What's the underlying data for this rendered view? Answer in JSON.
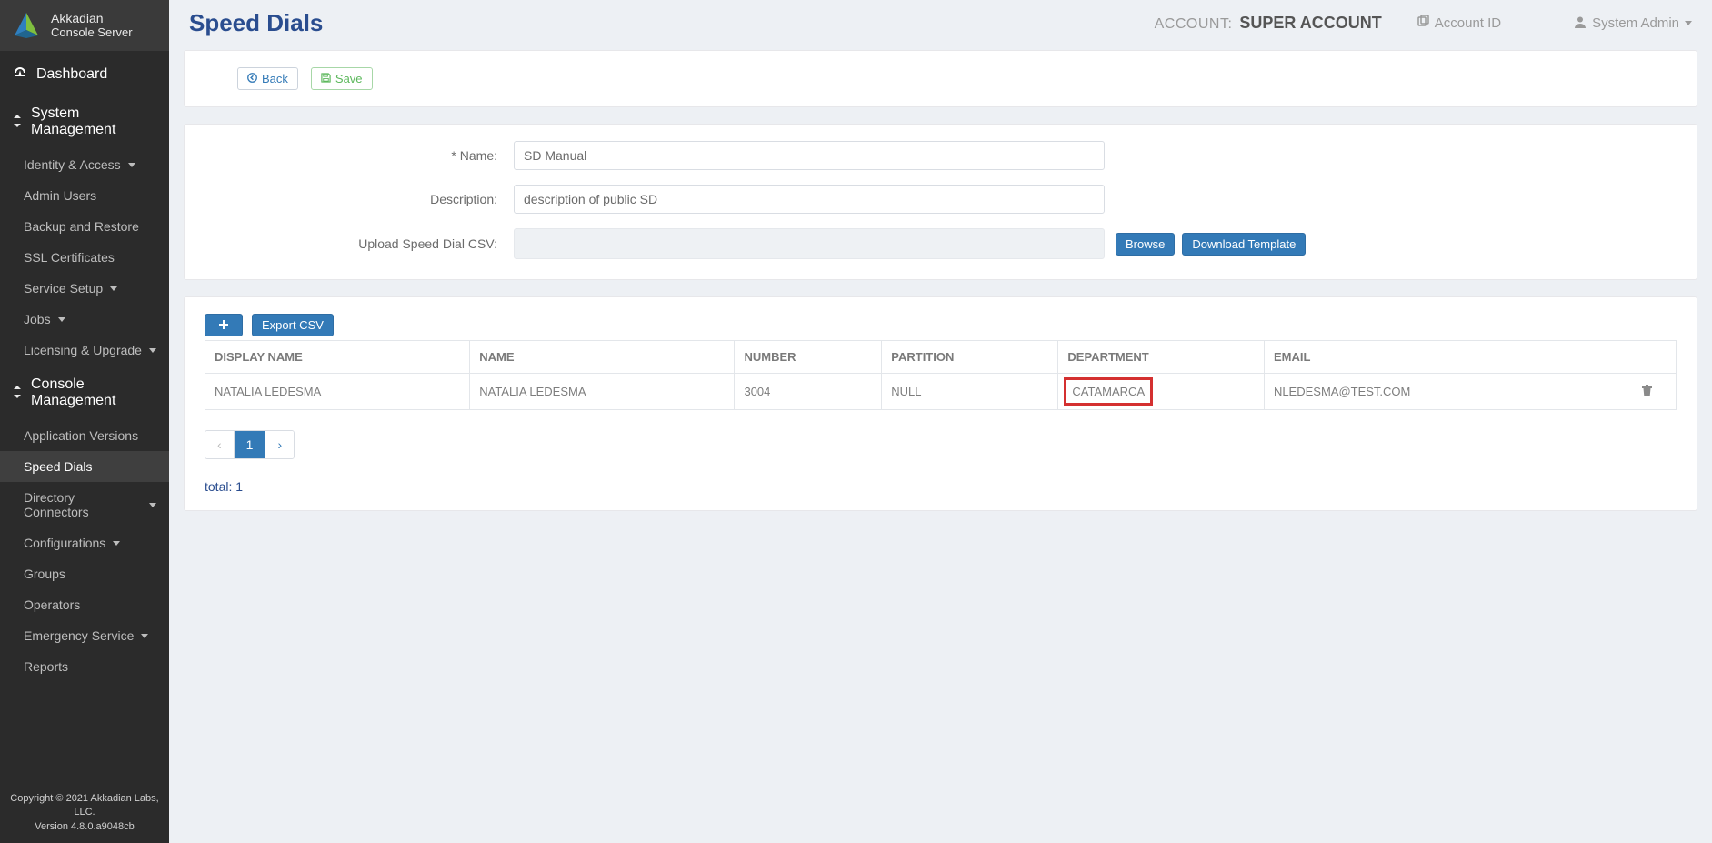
{
  "brand": {
    "line1": "Akkadian",
    "line2": "Console Server"
  },
  "sidebar": {
    "dashboard": "Dashboard",
    "sections": [
      {
        "title": "System Management",
        "items": [
          {
            "label": "Identity & Access",
            "caret": true
          },
          {
            "label": "Admin Users"
          },
          {
            "label": "Backup and Restore"
          },
          {
            "label": "SSL Certificates"
          },
          {
            "label": "Service Setup",
            "caret": true
          },
          {
            "label": "Jobs",
            "caret": true
          },
          {
            "label": "Licensing & Upgrade",
            "caret": true
          }
        ]
      },
      {
        "title": "Console Management",
        "items": [
          {
            "label": "Application Versions"
          },
          {
            "label": "Speed Dials",
            "active": true
          },
          {
            "label": "Directory Connectors",
            "caret": true
          },
          {
            "label": "Configurations",
            "caret": true
          },
          {
            "label": "Groups"
          },
          {
            "label": "Operators"
          },
          {
            "label": "Emergency Service",
            "caret": true
          },
          {
            "label": "Reports"
          }
        ]
      }
    ],
    "footer": {
      "copyright": "Copyright © 2021 Akkadian Labs, LLC.",
      "version": "Version 4.8.0.a9048cb"
    }
  },
  "topbar": {
    "page_title": "Speed Dials",
    "account_label": "ACCOUNT:",
    "account_name": "SUPER ACCOUNT",
    "account_id_link": "Account ID",
    "user_menu": "System Admin"
  },
  "actions": {
    "back": "Back",
    "save": "Save"
  },
  "form": {
    "name_label": "* Name:",
    "name_value": "SD Manual",
    "desc_label": "Description:",
    "desc_value": "description of public SD",
    "upload_label": "Upload Speed Dial CSV:",
    "browse": "Browse",
    "download_template": "Download Template"
  },
  "table": {
    "export_csv": "Export CSV",
    "headers": {
      "display_name": "DISPLAY NAME",
      "name": "NAME",
      "number": "NUMBER",
      "partition": "PARTITION",
      "department": "DEPARTMENT",
      "email": "EMAIL"
    },
    "rows": [
      {
        "display_name": "NATALIA LEDESMA",
        "name": "NATALIA LEDESMA",
        "number": "3004",
        "partition": "NULL",
        "department": "CATAMARCA",
        "email": "NLEDESMA@TEST.COM"
      }
    ],
    "pagination": {
      "prev": "‹",
      "pages": [
        "1"
      ],
      "next": "›",
      "active": "1"
    },
    "total_label": "total: 1"
  }
}
